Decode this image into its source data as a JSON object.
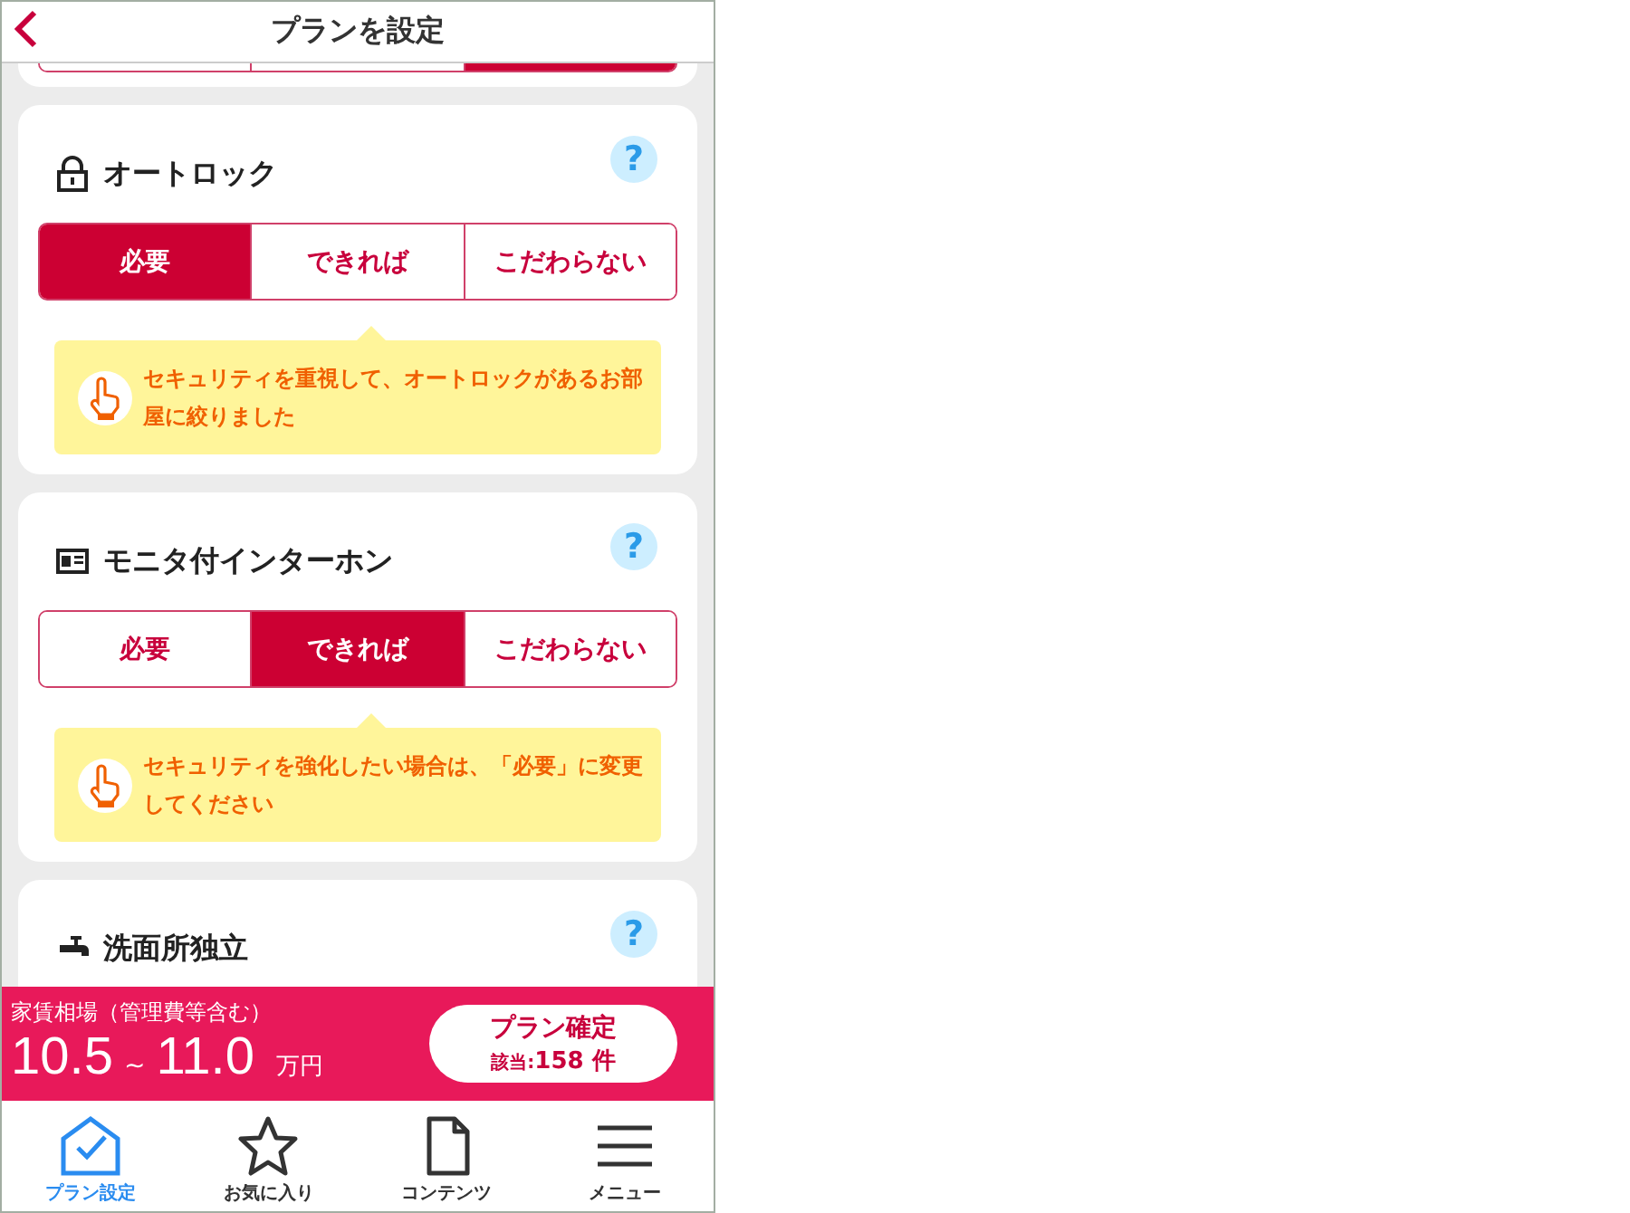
{
  "header": {
    "title": "プランを設定"
  },
  "partial_card": {
    "options": [
      {
        "selected": false
      },
      {
        "selected": false
      },
      {
        "selected": true
      }
    ]
  },
  "cards": [
    {
      "title": "オートロック",
      "help": "?",
      "options": [
        {
          "label": "必要",
          "selected": true
        },
        {
          "label": "できれば",
          "selected": false
        },
        {
          "label": "こだわらない",
          "selected": false
        }
      ],
      "tip": "セキュリティを重視して、オートロックがあるお部屋に絞りました"
    },
    {
      "title": "モニタ付インターホン",
      "help": "?",
      "options": [
        {
          "label": "必要",
          "selected": false
        },
        {
          "label": "できれば",
          "selected": true
        },
        {
          "label": "こだわらない",
          "selected": false
        }
      ],
      "tip": "セキュリティを強化したい場合は、「必要」に変更してください"
    },
    {
      "title": "洗面所独立",
      "help": "?"
    }
  ],
  "price_bar": {
    "label": "家賃相場（管理費等含む）",
    "min": "10.5",
    "separator": "~",
    "max": "11.0",
    "unit": "万円",
    "confirm": {
      "label": "プラン確定",
      "count_label": "該当:",
      "count": "158 件"
    }
  },
  "tab_bar": [
    {
      "label": "プラン設定",
      "selected": true
    },
    {
      "label": "お気に入り",
      "selected": false
    },
    {
      "label": "コンテンツ",
      "selected": false
    },
    {
      "label": "メニュー",
      "selected": false
    }
  ]
}
